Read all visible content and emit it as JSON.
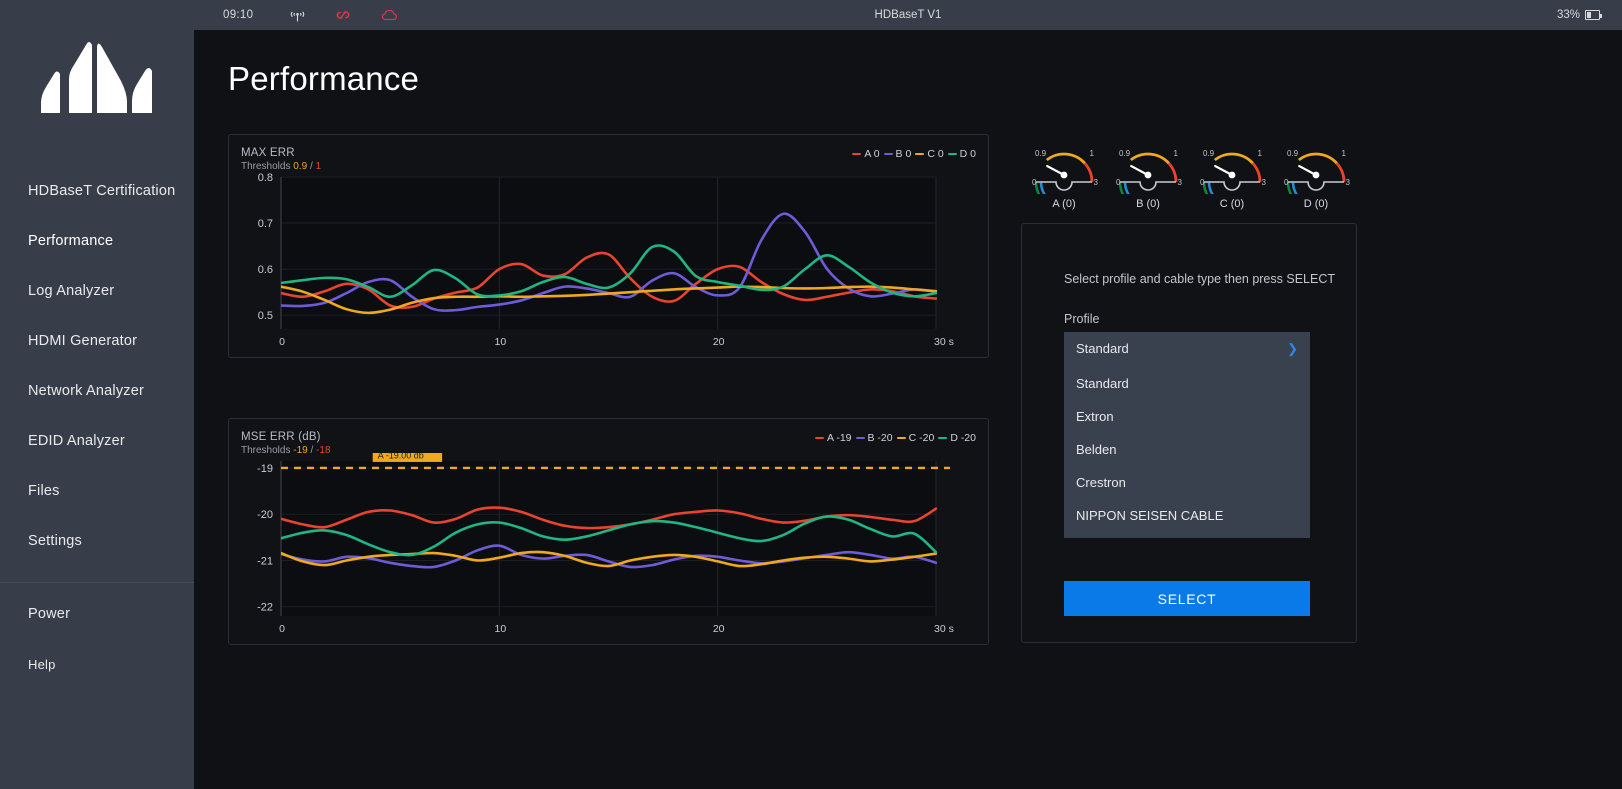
{
  "topbar": {
    "time": "09:10",
    "title": "HDBaseT V1",
    "battery_percent": "33%",
    "icons": [
      "wifi-icon",
      "link-icon",
      "cloud-icon"
    ]
  },
  "sidebar": {
    "logo": "mountain-logo",
    "items": [
      {
        "label": "HDBaseT Certification",
        "active": false
      },
      {
        "label": "Performance",
        "active": true
      },
      {
        "label": "Log Analyzer",
        "active": false
      },
      {
        "label": "HDMI Generator",
        "active": false
      },
      {
        "label": "Network Analyzer",
        "active": false
      },
      {
        "label": "EDID Analyzer",
        "active": false
      },
      {
        "label": "Files",
        "active": false
      },
      {
        "label": "Settings",
        "active": false
      }
    ],
    "footer_items": [
      {
        "label": "Power"
      },
      {
        "label": "Help"
      }
    ]
  },
  "page": {
    "title": "Performance"
  },
  "gauges": [
    {
      "label": "A (0)",
      "min": "0",
      "max": "3",
      "warn": "0.9",
      "crit": "1",
      "value": 0
    },
    {
      "label": "B (0)",
      "min": "0",
      "max": "3",
      "warn": "0.9",
      "crit": "1",
      "value": 0
    },
    {
      "label": "C (0)",
      "min": "0",
      "max": "3",
      "warn": "0.9",
      "crit": "1",
      "value": 0
    },
    {
      "label": "D (0)",
      "min": "0",
      "max": "3",
      "warn": "0.9",
      "crit": "1",
      "value": 0
    }
  ],
  "profile_panel": {
    "hint": "Select profile and cable type then press SELECT",
    "profile_label": "Profile",
    "selected": "Standard",
    "options": [
      "Standard",
      "Extron",
      "Belden",
      "Crestron",
      "NIPPON SEISEN CABLE"
    ],
    "select_button": "SELECT",
    "accent": "#0a7ae8"
  },
  "chart_data": [
    {
      "type": "line",
      "title": "MAX ERR",
      "threshold_label": "Thresholds",
      "threshold_warn": "0.9",
      "threshold_crit": "1",
      "xlabel": "30 s",
      "ylabel": "",
      "x": [
        0,
        1,
        2,
        3,
        4,
        5,
        6,
        7,
        8,
        9,
        10,
        11,
        12,
        13,
        14,
        15,
        16,
        17,
        18,
        19,
        20,
        21,
        22,
        23,
        24,
        25,
        26,
        27,
        28,
        29,
        30
      ],
      "xticks": [
        "0",
        "10",
        "20",
        "30 s"
      ],
      "yticks": [
        "0.5",
        "0.6",
        "0.7",
        "0.8"
      ],
      "ylim": [
        0.47,
        0.8
      ],
      "xlim": [
        0,
        30
      ],
      "grid": true,
      "legend_position": "top-right",
      "series": [
        {
          "name": "A 0",
          "legend": "A 0",
          "color": "#e8442f",
          "values": [
            0.548,
            0.54,
            0.552,
            0.568,
            0.556,
            0.521,
            0.518,
            0.536,
            0.549,
            0.56,
            0.6,
            0.611,
            0.586,
            0.589,
            0.625,
            0.632,
            0.58,
            0.54,
            0.531,
            0.568,
            0.6,
            0.605,
            0.572,
            0.546,
            0.533,
            0.54,
            0.549,
            0.556,
            0.552,
            0.541,
            0.536
          ]
        },
        {
          "name": "B 0",
          "legend": "B 0",
          "color": "#6f5bd8",
          "values": [
            0.521,
            0.52,
            0.527,
            0.548,
            0.572,
            0.576,
            0.54,
            0.513,
            0.511,
            0.518,
            0.523,
            0.532,
            0.548,
            0.562,
            0.558,
            0.548,
            0.54,
            0.575,
            0.591,
            0.561,
            0.543,
            0.56,
            0.663,
            0.72,
            0.681,
            0.601,
            0.558,
            0.541,
            0.547,
            0.556,
            0.551
          ]
        },
        {
          "name": "C 0",
          "legend": "C 0",
          "color": "#f0a81e",
          "values": [
            0.562,
            0.551,
            0.533,
            0.513,
            0.505,
            0.512,
            0.527,
            0.537,
            0.54,
            0.54,
            0.541,
            0.54,
            0.541,
            0.542,
            0.544,
            0.547,
            0.55,
            0.553,
            0.556,
            0.558,
            0.56,
            0.562,
            0.561,
            0.559,
            0.558,
            0.559,
            0.561,
            0.562,
            0.56,
            0.556,
            0.552
          ]
        },
        {
          "name": "D 0",
          "legend": "D 0",
          "color": "#1fb682",
          "values": [
            0.57,
            0.576,
            0.581,
            0.578,
            0.561,
            0.54,
            0.565,
            0.598,
            0.58,
            0.545,
            0.543,
            0.552,
            0.572,
            0.583,
            0.568,
            0.56,
            0.591,
            0.648,
            0.638,
            0.585,
            0.572,
            0.564,
            0.555,
            0.562,
            0.6,
            0.63,
            0.605,
            0.571,
            0.549,
            0.541,
            0.548
          ]
        }
      ]
    },
    {
      "type": "line",
      "title": "MSE ERR (dB)",
      "threshold_label": "Thresholds",
      "threshold_warn": "-19",
      "threshold_crit": "-18",
      "threshold_line": -19,
      "tooltip": "A -19.00 db",
      "xlabel": "30 s",
      "ylabel": "",
      "x": [
        0,
        1,
        2,
        3,
        4,
        5,
        6,
        7,
        8,
        9,
        10,
        11,
        12,
        13,
        14,
        15,
        16,
        17,
        18,
        19,
        20,
        21,
        22,
        23,
        24,
        25,
        26,
        27,
        28,
        29,
        30
      ],
      "xticks": [
        "0",
        "10",
        "20",
        "30 s"
      ],
      "yticks": [
        "-19",
        "-20",
        "-21",
        "-22"
      ],
      "ylim": [
        -22.2,
        -18.85
      ],
      "xlim": [
        0,
        30
      ],
      "grid": true,
      "legend_position": "top-right",
      "series": [
        {
          "name": "A -19",
          "legend": "A -19",
          "color": "#e8442f",
          "values": [
            -20.1,
            -20.22,
            -20.28,
            -20.12,
            -19.95,
            -19.92,
            -20.02,
            -20.18,
            -20.1,
            -19.9,
            -19.86,
            -19.95,
            -20.12,
            -20.25,
            -20.3,
            -20.28,
            -20.22,
            -20.12,
            -20.0,
            -19.95,
            -19.92,
            -19.98,
            -20.1,
            -20.18,
            -20.14,
            -20.05,
            -20.02,
            -20.06,
            -20.12,
            -20.15,
            -19.88
          ]
        },
        {
          "name": "B -20",
          "legend": "B -20",
          "color": "#6f5bd8",
          "values": [
            -20.86,
            -20.98,
            -21.02,
            -20.92,
            -20.95,
            -21.05,
            -21.12,
            -21.14,
            -21.0,
            -20.78,
            -20.68,
            -20.88,
            -20.96,
            -20.9,
            -20.88,
            -21.02,
            -21.14,
            -21.1,
            -20.98,
            -20.9,
            -20.92,
            -21.0,
            -21.06,
            -21.02,
            -20.95,
            -20.88,
            -20.82,
            -20.88,
            -20.96,
            -20.92,
            -21.05
          ]
        },
        {
          "name": "C -20",
          "legend": "C -20",
          "color": "#f0a81e",
          "values": [
            -20.84,
            -21.02,
            -21.1,
            -21.0,
            -20.92,
            -20.88,
            -20.86,
            -20.84,
            -20.9,
            -21.0,
            -20.94,
            -20.84,
            -20.82,
            -20.9,
            -21.05,
            -21.12,
            -21.0,
            -20.92,
            -20.88,
            -20.92,
            -21.02,
            -21.12,
            -21.08,
            -21.0,
            -20.94,
            -20.92,
            -20.96,
            -21.02,
            -20.98,
            -20.92,
            -20.85
          ]
        },
        {
          "name": "D -20",
          "legend": "D -20",
          "color": "#1fb682",
          "values": [
            -20.52,
            -20.4,
            -20.35,
            -20.45,
            -20.65,
            -20.82,
            -20.88,
            -20.7,
            -20.4,
            -20.22,
            -20.18,
            -20.3,
            -20.48,
            -20.55,
            -20.48,
            -20.35,
            -20.22,
            -20.15,
            -20.18,
            -20.28,
            -20.4,
            -20.52,
            -20.58,
            -20.45,
            -20.2,
            -20.05,
            -20.12,
            -20.32,
            -20.48,
            -20.42,
            -20.82
          ]
        }
      ]
    }
  ]
}
